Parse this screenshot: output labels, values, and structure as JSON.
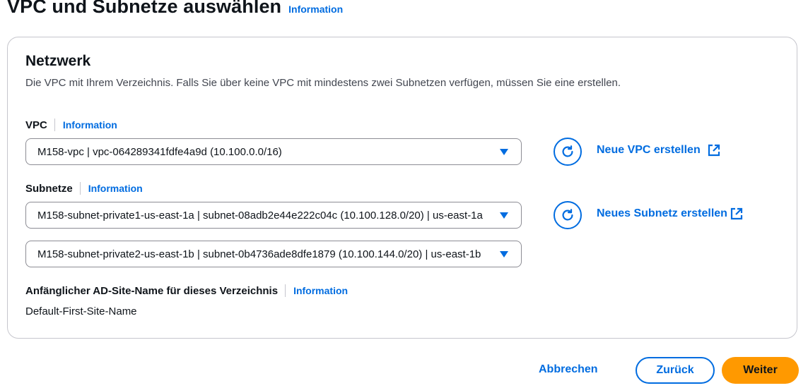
{
  "header": {
    "title": "VPC und Subnetze auswählen",
    "info_link": "Information"
  },
  "network": {
    "title": "Netzwerk",
    "description": "Die VPC mit Ihrem Verzeichnis. Falls Sie über keine VPC mit mindestens zwei Subnetzen verfügen, müssen Sie eine erstellen.",
    "vpc": {
      "label": "VPC",
      "info_link": "Information",
      "value": "M158-vpc | vpc-064289341fdfe4a9d (10.100.0.0/16)",
      "create_link": "Neue VPC erstellen"
    },
    "subnets": {
      "label": "Subnetze",
      "info_link": "Information",
      "values": [
        "M158-subnet-private1-us-east-1a | subnet-08adb2e44e222c04c (10.100.128.0/20) | us-east-1a",
        "M158-subnet-private2-us-east-1b | subnet-0b4736ade8dfe1879 (10.100.144.0/20) | us-east-1b"
      ],
      "create_link": "Neues Subnetz erstellen"
    },
    "ad_site": {
      "label": "Anfänglicher AD-Site-Name für dieses Verzeichnis",
      "info_link": "Information",
      "value": "Default-First-Site-Name"
    }
  },
  "footer": {
    "cancel_label": "Abbrechen",
    "back_label": "Zurück",
    "next_label": "Weiter"
  },
  "icons": {
    "refresh": "refresh-icon",
    "external": "external-link-icon",
    "caret": "caret-down-icon"
  },
  "colors": {
    "link": "#006ce0",
    "primary_button": "#ff9900",
    "border": "#c6c6cd"
  }
}
